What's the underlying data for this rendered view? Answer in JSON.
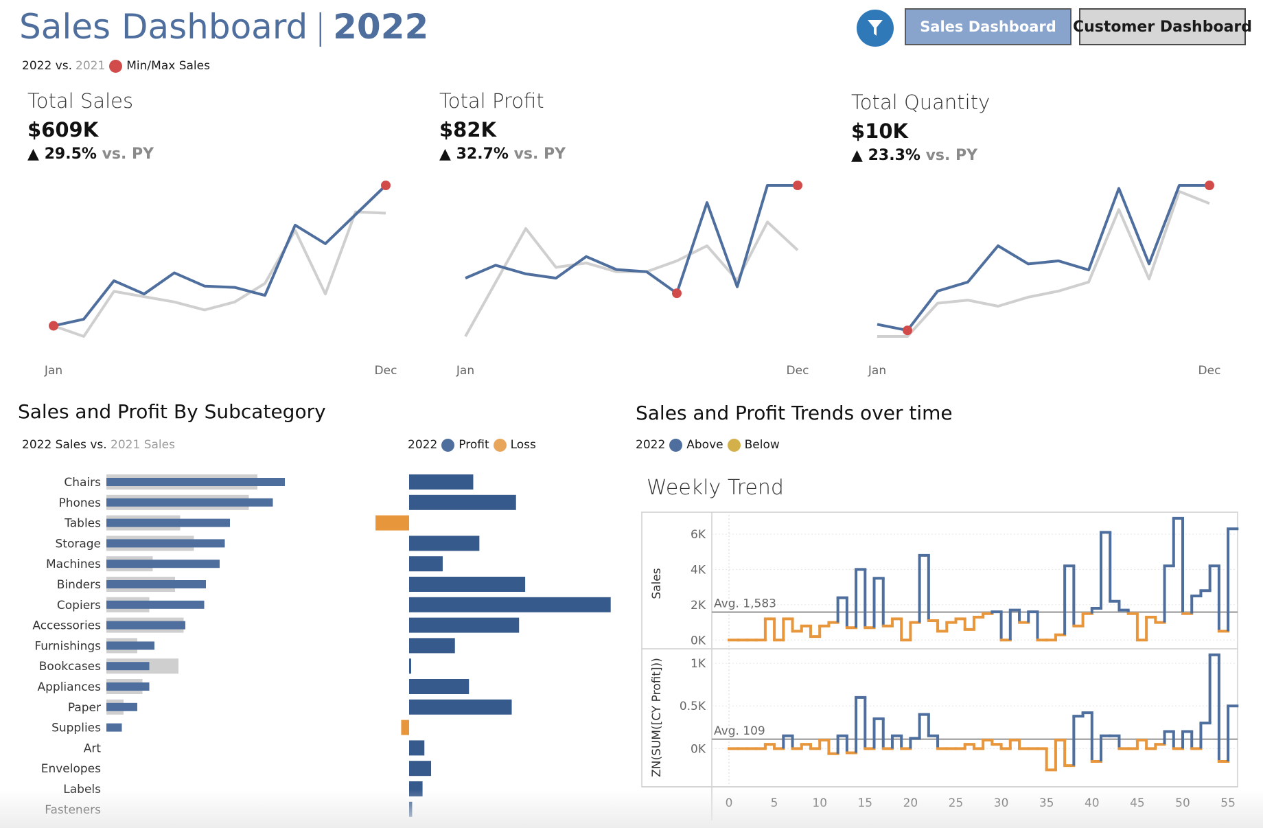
{
  "header": {
    "title": "Sales Dashboard",
    "separator": "|",
    "year": "2022",
    "legend": {
      "current": "2022 vs.",
      "previous": "2021",
      "minmax": "Min/Max Sales"
    }
  },
  "nav": {
    "filter_icon": "filter-icon",
    "sales_label": "Sales Dashboard",
    "customer_label": "Customer Dashboard"
  },
  "colors": {
    "current": "#4e6e9e",
    "previous": "#cfcfcf",
    "minmax": "#d24b4b",
    "profit": "#375a8c",
    "loss": "#e8963c",
    "above": "#4e6e9e",
    "below": "#e8963c",
    "filter": "#2f79b9"
  },
  "kpis": [
    {
      "label": "Total Sales",
      "value": "$609K",
      "arrow": "▲",
      "delta": "29.5%",
      "vs": "vs. PY",
      "x_start": "Jan",
      "x_end": "Dec",
      "cy": [
        430,
        455,
        600,
        550,
        630,
        580,
        575,
        545,
        810,
        740,
        850,
        960
      ],
      "py": [
        430,
        390,
        560,
        540,
        520,
        490,
        520,
        590,
        790,
        550,
        860,
        855
      ],
      "min_index": 0,
      "max_index": 11
    },
    {
      "label": "Total Profit",
      "value": "$82K",
      "arrow": "▲",
      "delta": "32.7%",
      "vs": "vs. PY",
      "x_start": "Jan",
      "x_end": "Dec",
      "cy": [
        57,
        63,
        59,
        57,
        67,
        61,
        60,
        50,
        92,
        53,
        100,
        100
      ],
      "py": [
        30,
        55,
        80,
        62,
        64,
        60,
        60,
        65,
        72,
        56,
        83,
        70
      ],
      "min_index": 7,
      "max_index": 11
    },
    {
      "label": "Total Quantity",
      "value": "$10K",
      "arrow": "▲",
      "delta": "23.3%",
      "vs": "vs. PY",
      "x_start": "Jan",
      "x_end": "Dec",
      "cy": [
        420,
        400,
        530,
        560,
        680,
        620,
        630,
        600,
        870,
        620,
        880,
        880
      ],
      "py": [
        380,
        380,
        490,
        500,
        480,
        510,
        530,
        560,
        800,
        570,
        860,
        820
      ],
      "min_index": 1,
      "max_index": 11
    }
  ],
  "subcategory": {
    "title": "Sales and Profit By Subcategory",
    "sales_legend": {
      "current": "2022 Sales vs.",
      "previous": "2021 Sales"
    },
    "profit_legend": {
      "year": "2022",
      "profit": "Profit",
      "loss": "Loss"
    },
    "categories": [
      "Chairs",
      "Phones",
      "Tables",
      "Storage",
      "Machines",
      "Binders",
      "Copiers",
      "Accessories",
      "Furnishings",
      "Bookcases",
      "Appliances",
      "Paper",
      "Supplies",
      "Art",
      "Envelopes",
      "Labels",
      "Fasteners"
    ],
    "sales_cy": [
      104,
      97,
      72,
      69,
      66,
      58,
      57,
      46,
      28,
      25,
      25,
      18,
      9,
      0,
      0,
      0,
      0
    ],
    "sales_py": [
      88,
      83,
      43,
      51,
      27,
      40,
      25,
      45,
      18,
      42,
      21,
      10,
      0,
      0,
      0,
      0,
      0
    ],
    "profit": [
      10.5,
      17.5,
      -5.5,
      11.5,
      5.5,
      19,
      33,
      18,
      7.5,
      0.3,
      9.8,
      16.8,
      -1.3,
      2.5,
      3.6,
      2.2,
      0.5
    ]
  },
  "trends": {
    "title": "Sales and Profit Trends over time",
    "legend": {
      "year": "2022",
      "above": "Above",
      "below": "Below"
    },
    "weekly_title": "Weekly Trend",
    "sales": {
      "ylabel": "Sales",
      "avg": 1583,
      "avg_label": "Avg. 1,583",
      "ticks": [
        "0K",
        "2K",
        "4K",
        "6K"
      ],
      "tick_values": [
        0,
        2000,
        4000,
        6000
      ],
      "ymin": -300,
      "ymax": 6700,
      "values": [
        0,
        0,
        0,
        0,
        1200,
        0,
        1200,
        500,
        800,
        200,
        800,
        1000,
        2400,
        700,
        4000,
        700,
        3500,
        800,
        1200,
        0,
        1000,
        4800,
        1100,
        500,
        1000,
        1200,
        600,
        1300,
        1500,
        1600,
        0,
        1700,
        1000,
        1600,
        0,
        0,
        300,
        4200,
        800,
        1500,
        1800,
        6100,
        2200,
        1700,
        1500,
        0,
        1300,
        1000,
        4200,
        6900,
        1500,
        2500,
        2800,
        4200,
        500,
        6300
      ]
    },
    "profit": {
      "ylabel": "ZN(SUM([CY Profit]))",
      "avg": 109,
      "avg_label": "Avg. 109",
      "ticks": [
        "0K",
        "0.5K",
        "1K"
      ],
      "tick_values": [
        0,
        500,
        1000
      ],
      "ymin": -400,
      "ymax": 1130,
      "values": [
        0,
        0,
        0,
        0,
        50,
        0,
        150,
        0,
        50,
        0,
        100,
        -60,
        150,
        -50,
        600,
        0,
        350,
        0,
        150,
        0,
        120,
        400,
        150,
        0,
        0,
        0,
        50,
        0,
        100,
        50,
        0,
        100,
        0,
        0,
        0,
        -250,
        100,
        -200,
        380,
        420,
        -150,
        150,
        150,
        0,
        0,
        100,
        0,
        50,
        200,
        0,
        200,
        0,
        300,
        1100,
        -150,
        500
      ]
    },
    "x_ticks": [
      "0",
      "5",
      "10",
      "15",
      "20",
      "25",
      "30",
      "35",
      "40",
      "45",
      "50",
      "55"
    ],
    "x_tick_values": [
      0,
      5,
      10,
      15,
      20,
      25,
      30,
      35,
      40,
      45,
      50,
      55
    ]
  }
}
